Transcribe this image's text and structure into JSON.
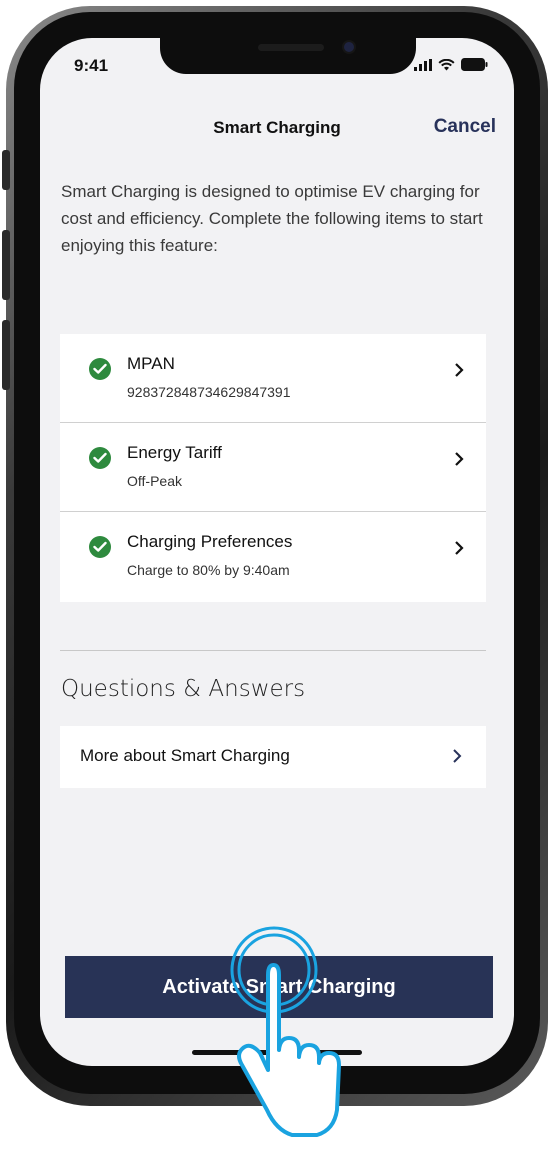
{
  "status_bar": {
    "time": "9:41"
  },
  "nav": {
    "title": "Smart Charging",
    "cancel_label": "Cancel"
  },
  "intro_text": "Smart Charging is designed to optimise EV charging for cost and efficiency. Complete the following items to start enjoying this feature:",
  "checklist": [
    {
      "title": "MPAN",
      "subtitle": "92837284873462984739​1",
      "status": "complete"
    },
    {
      "title": "Energy Tariff",
      "subtitle": "Off-Peak",
      "status": "complete"
    },
    {
      "title": "Charging Preferences",
      "subtitle": "Charge to 80% by 9:40am",
      "status": "complete"
    }
  ],
  "qa": {
    "heading": "Questions & Answers",
    "items": [
      {
        "label": "More about Smart Charging"
      }
    ]
  },
  "activate_button": {
    "label": "Activate Smart Charging"
  },
  "colors": {
    "accent": "#283356",
    "check": "#2e8a3e",
    "background": "#f2f2f4",
    "touch_indicator": "#1aa3e0"
  },
  "icons": [
    "check-circle-icon",
    "chevron-right-icon",
    "signal-icon",
    "wifi-icon",
    "battery-icon",
    "hand-pointer-icon"
  ]
}
